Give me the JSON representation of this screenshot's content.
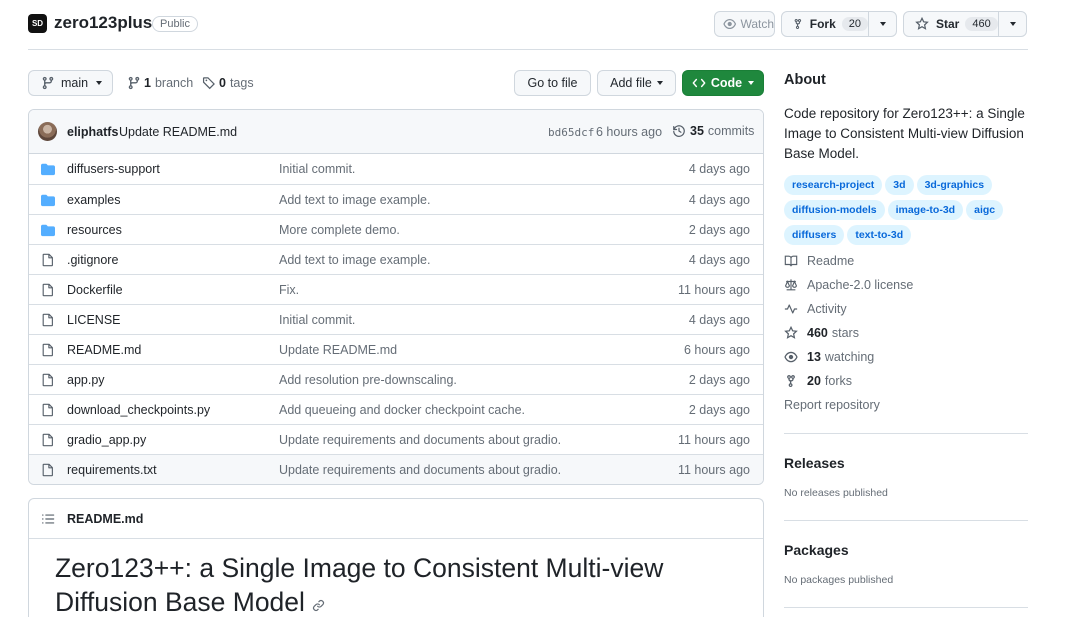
{
  "repo": {
    "name": "zero123plus",
    "visibility": "Public",
    "logo_text": "SD"
  },
  "actions": {
    "watch_label": "Watch",
    "fork_label": "Fork",
    "fork_count": "20",
    "star_label": "Star",
    "star_count": "460"
  },
  "toolbar": {
    "branch_name": "main",
    "branch_count": "1",
    "branch_label": "branch",
    "tag_count": "0",
    "tag_label": "tags",
    "goto_file": "Go to file",
    "add_file": "Add file",
    "code": "Code"
  },
  "latest_commit": {
    "author": "eliphatfs",
    "message": "Update README.md",
    "hash": "bd65dcf",
    "time": "6 hours ago",
    "commit_count": "35",
    "commit_label": "commits"
  },
  "files": [
    {
      "type": "folder",
      "name": "diffusers-support",
      "message": "Initial commit.",
      "age": "4 days ago"
    },
    {
      "type": "folder",
      "name": "examples",
      "message": "Add text to image example.",
      "age": "4 days ago"
    },
    {
      "type": "folder",
      "name": "resources",
      "message": "More complete demo.",
      "age": "2 days ago"
    },
    {
      "type": "file",
      "name": ".gitignore",
      "message": "Add text to image example.",
      "age": "4 days ago"
    },
    {
      "type": "file",
      "name": "Dockerfile",
      "message": "Fix.",
      "age": "11 hours ago"
    },
    {
      "type": "file",
      "name": "LICENSE",
      "message": "Initial commit.",
      "age": "4 days ago"
    },
    {
      "type": "file",
      "name": "README.md",
      "message": "Update README.md",
      "age": "6 hours ago"
    },
    {
      "type": "file",
      "name": "app.py",
      "message": "Add resolution pre-downscaling.",
      "age": "2 days ago"
    },
    {
      "type": "file",
      "name": "download_checkpoints.py",
      "message": "Add queueing and docker checkpoint cache.",
      "age": "2 days ago"
    },
    {
      "type": "file",
      "name": "gradio_app.py",
      "message": "Update requirements and documents about gradio.",
      "age": "11 hours ago"
    },
    {
      "type": "file",
      "name": "requirements.txt",
      "message": "Update requirements and documents about gradio.",
      "age": "11 hours ago"
    }
  ],
  "readme": {
    "file_label": "README.md",
    "heading_line1": "Zero123++: a Single Image to Consistent Multi-view",
    "heading_line2": "Diffusion Base Model"
  },
  "about": {
    "title": "About",
    "description_line1": "Code repository for Zero123++: a Single",
    "description_line2": "Image to Consistent Multi-view Diffusion",
    "description_line3": "Base Model.",
    "topics": [
      "research-project",
      "3d",
      "3d-graphics",
      "diffusion-models",
      "image-to-3d",
      "aigc",
      "diffusers",
      "text-to-3d"
    ],
    "readme_link": "Readme",
    "license_link": "Apache-2.0 license",
    "activity_link": "Activity",
    "stars_count": "460",
    "stars_label": "stars",
    "watching_count": "13",
    "watching_label": "watching",
    "forks_count": "20",
    "forks_label": "forks",
    "report_link": "Report repository"
  },
  "releases": {
    "title": "Releases",
    "empty": "No releases published"
  },
  "packages": {
    "title": "Packages",
    "empty": "No packages published"
  },
  "colors": {
    "accent_green": "#1f883d",
    "link_blue": "#0969da",
    "folder_blue": "#54aeff",
    "topic_bg": "#ddf4ff"
  }
}
